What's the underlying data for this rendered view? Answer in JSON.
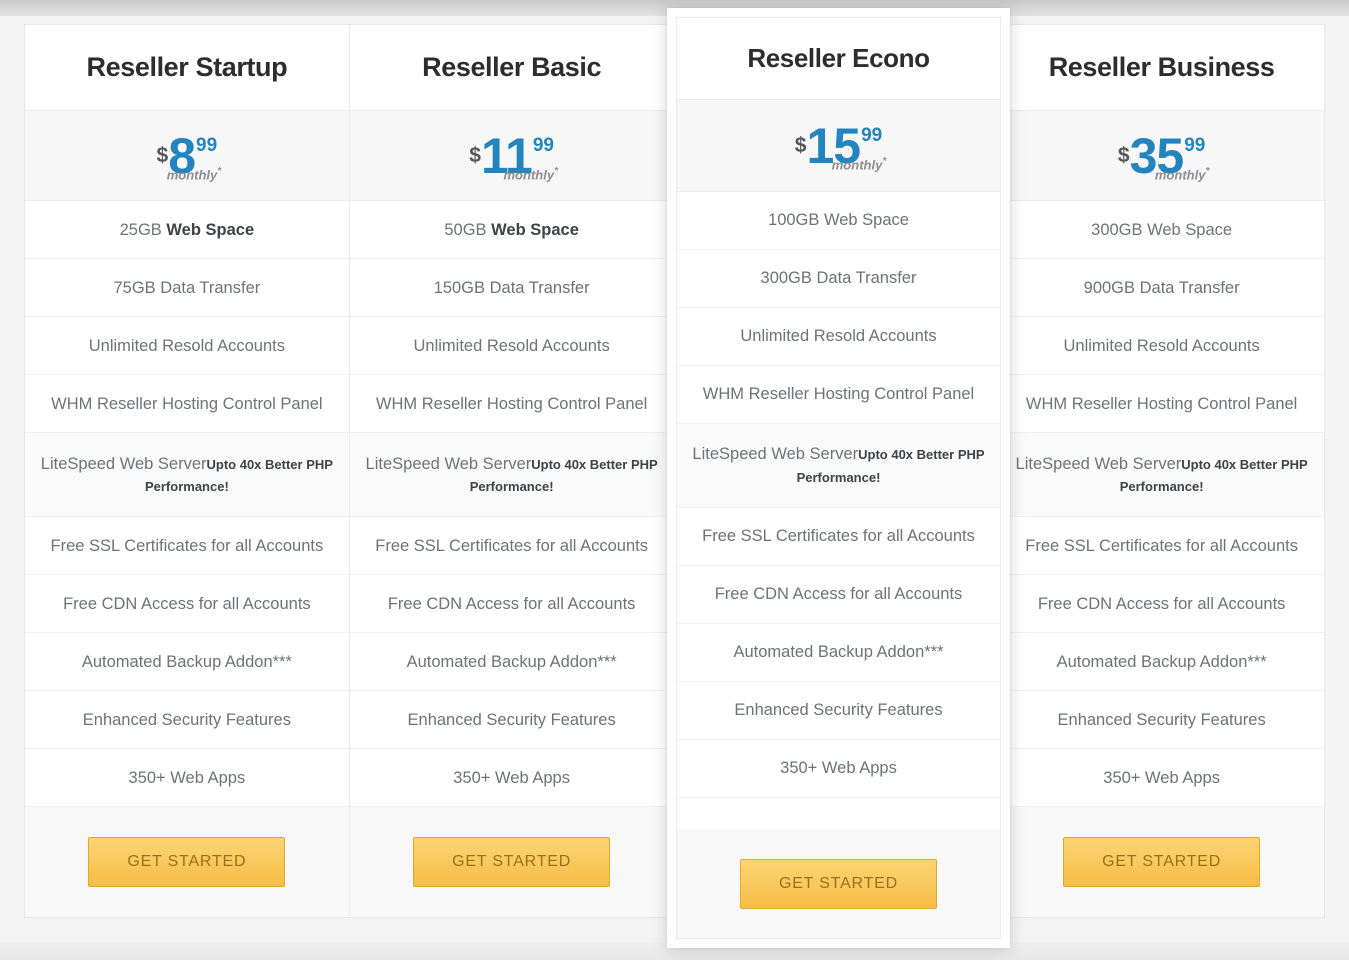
{
  "page": {
    "background_color": "#f4f4f4",
    "accent_blue": "#2484bd",
    "cta_color": "#f8c85b",
    "cta_text_color": "#9c6f1c"
  },
  "plans": [
    {
      "name": "Reseller Startup",
      "featured": false,
      "price": {
        "currency": "$",
        "amount": "8",
        "cents": "99",
        "period": "monthly",
        "period_star": "*"
      },
      "features": [
        {
          "text": "25GB Web Space",
          "lead": "25GB",
          "rest": " Web Space",
          "strong_part": "rest"
        },
        {
          "text": "75GB Data Transfer"
        },
        {
          "text": "Unlimited Resold Accounts"
        },
        {
          "text": "WHM Reseller Hosting Control Panel"
        },
        {
          "text": "LiteSpeed Web Server",
          "sub": "Upto 40x Better PHP Performance!"
        },
        {
          "text": "Free SSL Certificates for all Accounts"
        },
        {
          "text": "Free CDN Access for all Accounts"
        },
        {
          "text": "Automated Backup Addon***"
        },
        {
          "text": "Enhanced Security Features"
        },
        {
          "text": "350+ Web Apps"
        }
      ],
      "cta": "GET STARTED"
    },
    {
      "name": "Reseller Basic",
      "featured": false,
      "price": {
        "currency": "$",
        "amount": "11",
        "cents": "99",
        "period": "monthly",
        "period_star": "*"
      },
      "features": [
        {
          "text": "50GB Web Space",
          "lead": "50GB",
          "rest": " Web Space",
          "strong_part": "rest"
        },
        {
          "text": "150GB Data Transfer"
        },
        {
          "text": "Unlimited Resold Accounts"
        },
        {
          "text": "WHM Reseller Hosting Control Panel"
        },
        {
          "text": "LiteSpeed Web Server",
          "sub": "Upto 40x Better PHP Performance!"
        },
        {
          "text": "Free SSL Certificates for all Accounts"
        },
        {
          "text": "Free CDN Access for all Accounts"
        },
        {
          "text": "Automated Backup Addon***"
        },
        {
          "text": "Enhanced Security Features"
        },
        {
          "text": "350+ Web Apps"
        }
      ],
      "cta": "GET STARTED"
    },
    {
      "name": "Reseller Econo",
      "featured": true,
      "price": {
        "currency": "$",
        "amount": "15",
        "cents": "99",
        "period": "monthly",
        "period_star": "*"
      },
      "features": [
        {
          "text": "100GB Web Space"
        },
        {
          "text": "300GB Data Transfer"
        },
        {
          "text": "Unlimited Resold Accounts"
        },
        {
          "text": "WHM Reseller Hosting Control Panel"
        },
        {
          "text": "LiteSpeed Web Server",
          "sub": "Upto 40x Better PHP Performance!"
        },
        {
          "text": "Free SSL Certificates for all Accounts"
        },
        {
          "text": "Free CDN Access for all Accounts"
        },
        {
          "text": "Automated Backup Addon***"
        },
        {
          "text": "Enhanced Security Features"
        },
        {
          "text": "350+ Web Apps"
        }
      ],
      "cta": "GET STARTED"
    },
    {
      "name": "Reseller Business",
      "featured": false,
      "price": {
        "currency": "$",
        "amount": "35",
        "cents": "99",
        "period": "monthly",
        "period_star": "*"
      },
      "features": [
        {
          "text": "300GB Web Space"
        },
        {
          "text": "900GB Data Transfer"
        },
        {
          "text": "Unlimited Resold Accounts"
        },
        {
          "text": "WHM Reseller Hosting Control Panel"
        },
        {
          "text": "LiteSpeed Web Server",
          "sub": "Upto 40x Better PHP Performance!"
        },
        {
          "text": "Free SSL Certificates for all Accounts"
        },
        {
          "text": "Free CDN Access for all Accounts"
        },
        {
          "text": "Automated Backup Addon***"
        },
        {
          "text": "Enhanced Security Features"
        },
        {
          "text": "350+ Web Apps"
        }
      ],
      "cta": "GET STARTED"
    }
  ]
}
